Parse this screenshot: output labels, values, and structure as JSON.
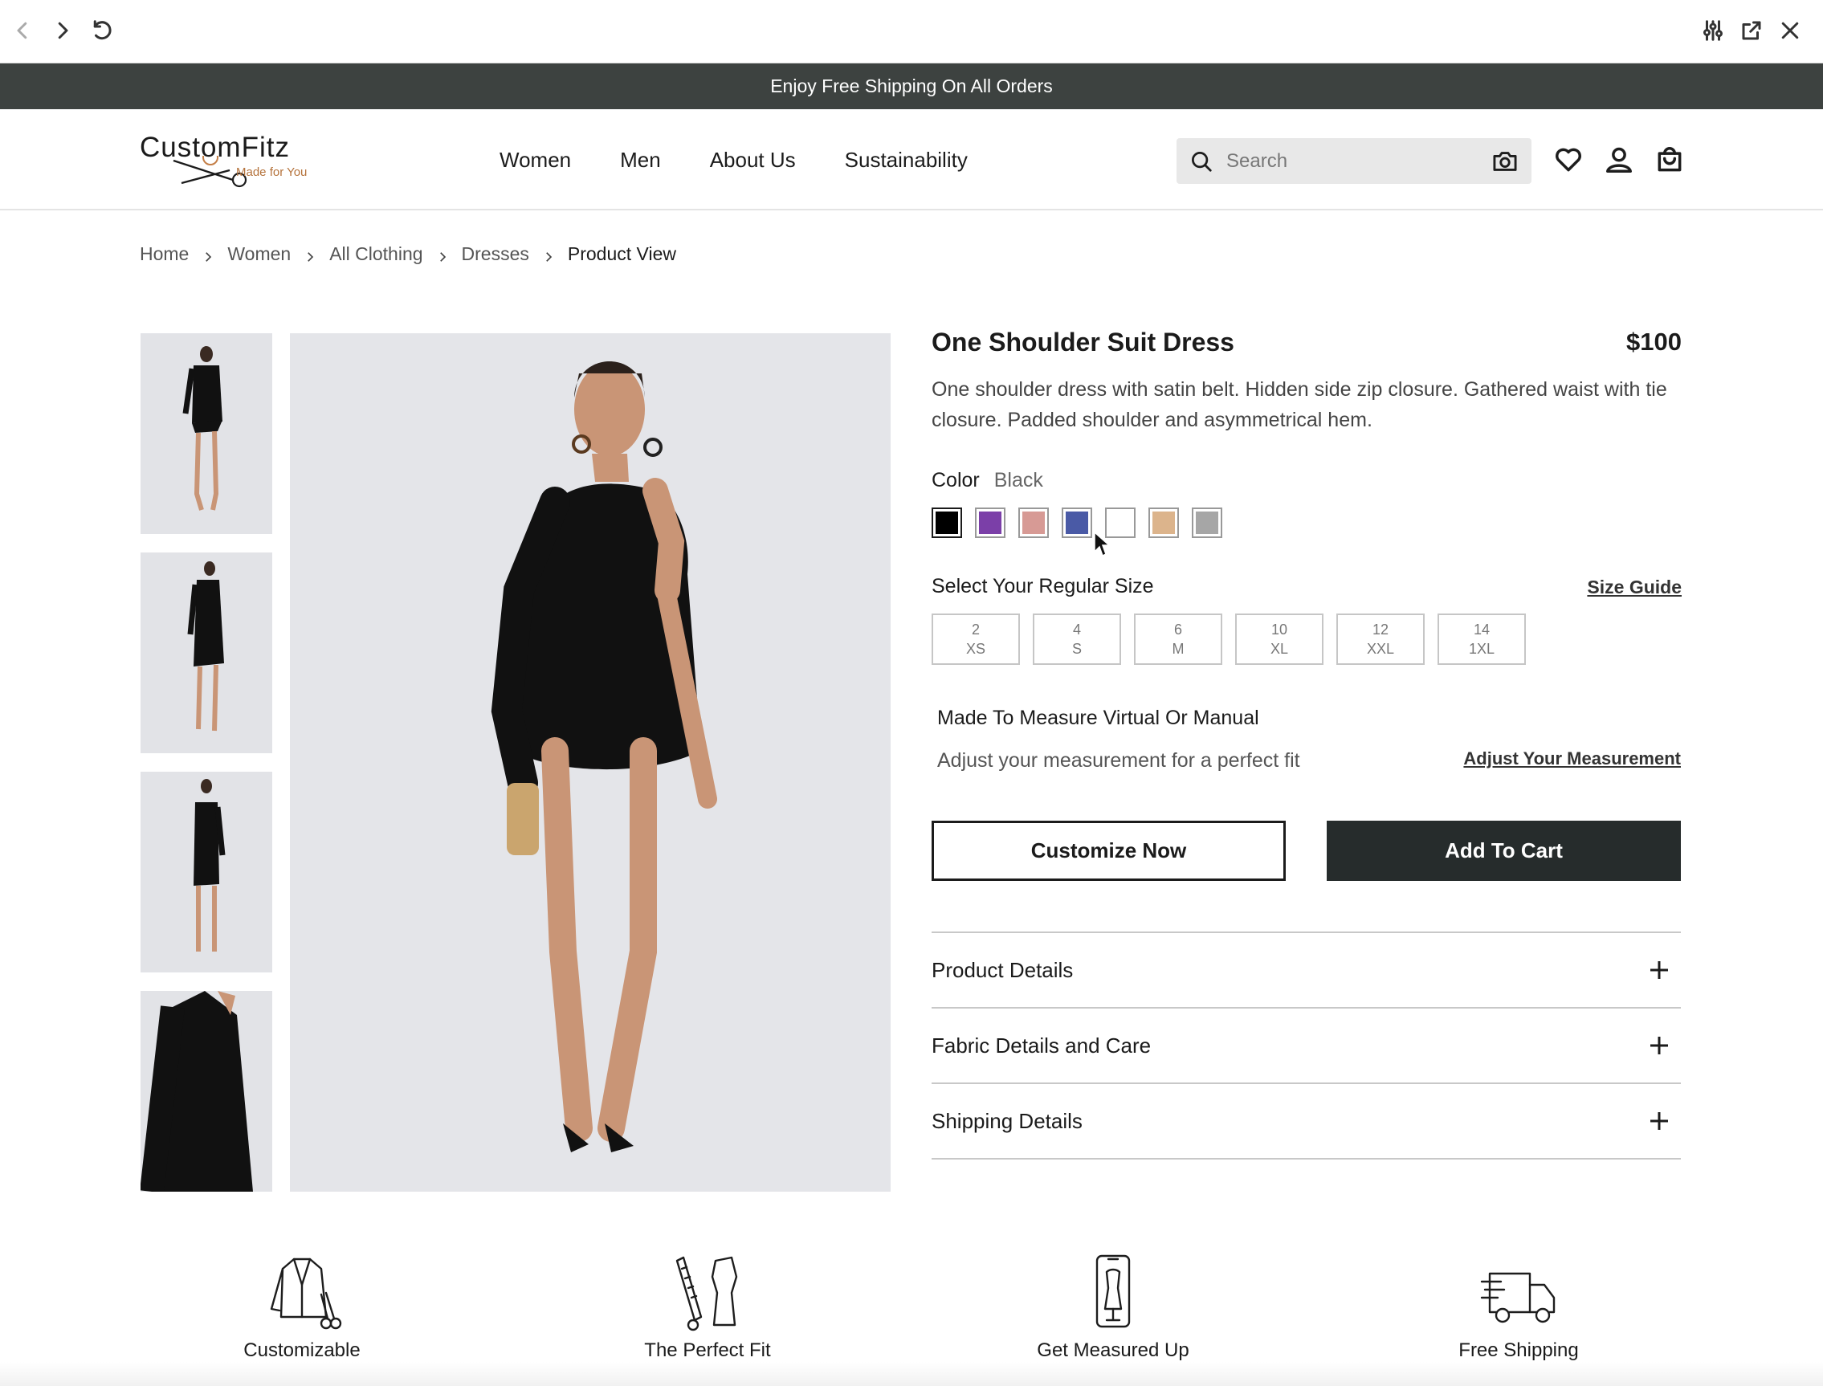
{
  "announcement": "Enjoy Free Shipping On All Orders",
  "logo": {
    "name": "CustomFitz",
    "tagline": "Made for You"
  },
  "nav": [
    "Women",
    "Men",
    "About Us",
    "Sustainability"
  ],
  "search": {
    "placeholder": "Search"
  },
  "breadcrumb": [
    "Home",
    "Women",
    "All Clothing",
    "Dresses",
    "Product View"
  ],
  "product": {
    "title": "One Shoulder Suit Dress",
    "price": "$100",
    "description": "One shoulder dress with satin belt. Hidden side zip closure. Gathered waist with tie closure. Padded shoulder and asymmetrical hem.",
    "color_label": "Color",
    "color_value": "Black",
    "swatches": [
      "#000000",
      "#7b3fa8",
      "#d79a95",
      "#4a5aa6",
      "#ffffff",
      "#dcb48c",
      "#a6a6a6"
    ],
    "size_title": "Select Your Regular Size",
    "size_guide": "Size Guide",
    "sizes": [
      {
        "num": "2",
        "label": "XS"
      },
      {
        "num": "4",
        "label": "S"
      },
      {
        "num": "6",
        "label": "M"
      },
      {
        "num": "10",
        "label": "XL"
      },
      {
        "num": "12",
        "label": "XXL"
      },
      {
        "num": "14",
        "label": "1XL"
      }
    ],
    "mtm_title": "Made To Measure Virtual Or Manual",
    "mtm_sub": "Adjust your measurement for a perfect fit",
    "mtm_link": "Adjust Your Measurement",
    "customize_label": "Customize Now",
    "cart_label": "Add To Cart",
    "accordion": [
      "Product Details",
      "Fabric Details and Care",
      "Shipping Details"
    ]
  },
  "features": [
    {
      "label": "Customizable",
      "icon": "jacket-scissors-icon"
    },
    {
      "label": "The Perfect Fit",
      "icon": "ruler-dress-form-icon"
    },
    {
      "label": "Get Measured Up",
      "icon": "phone-mannequin-icon"
    },
    {
      "label": "Free Shipping",
      "icon": "truck-icon"
    }
  ]
}
